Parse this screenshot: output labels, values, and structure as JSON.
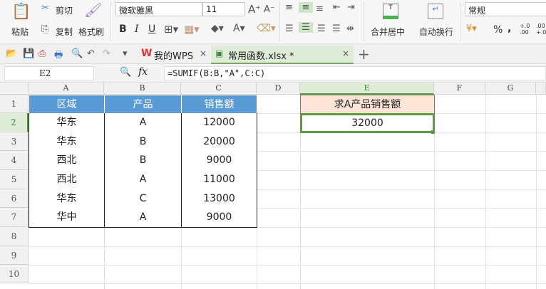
{
  "ribbon": {
    "paste": "粘贴",
    "cut": "剪切",
    "copy": "复制",
    "format_painter": "格式刷",
    "font_name": "微软雅黑",
    "font_size": "11",
    "bold": "B",
    "italic": "I",
    "underline": "U",
    "merge_center": "合并居中",
    "wrap_text": "自动换行",
    "number_format": "常规",
    "percent": "%",
    "comma": ",",
    "inc_decimal": "+.0 .00",
    "dec_decimal": ".00 +.0"
  },
  "tabs": [
    {
      "label": "我的WPS"
    },
    {
      "label": "常用函数.xlsx *"
    }
  ],
  "formula_bar": {
    "cell_ref": "E2",
    "fx": "fx",
    "formula": "=SUMIF(B:B,\"A\",C:C)"
  },
  "sheet": {
    "columns": [
      "A",
      "B",
      "C",
      "D",
      "E",
      "F",
      "G"
    ],
    "rows": [
      "1",
      "2",
      "3",
      "4",
      "5",
      "6",
      "7",
      "8",
      "9",
      "10"
    ],
    "table_header": [
      "区域",
      "产品",
      "销售额"
    ],
    "table_rows": [
      [
        "华东",
        "A",
        "12000"
      ],
      [
        "华东",
        "B",
        "20000"
      ],
      [
        "西北",
        "B",
        "9000"
      ],
      [
        "西北",
        "A",
        "11000"
      ],
      [
        "华东",
        "C",
        "13000"
      ],
      [
        "华中",
        "A",
        "9000"
      ]
    ],
    "e1": "求A产品销售额",
    "e2": "32000"
  },
  "colors": {
    "header_blue": "#5b9bd5",
    "header_peach": "#fce4d6",
    "select_green": "#5a9b3c"
  }
}
